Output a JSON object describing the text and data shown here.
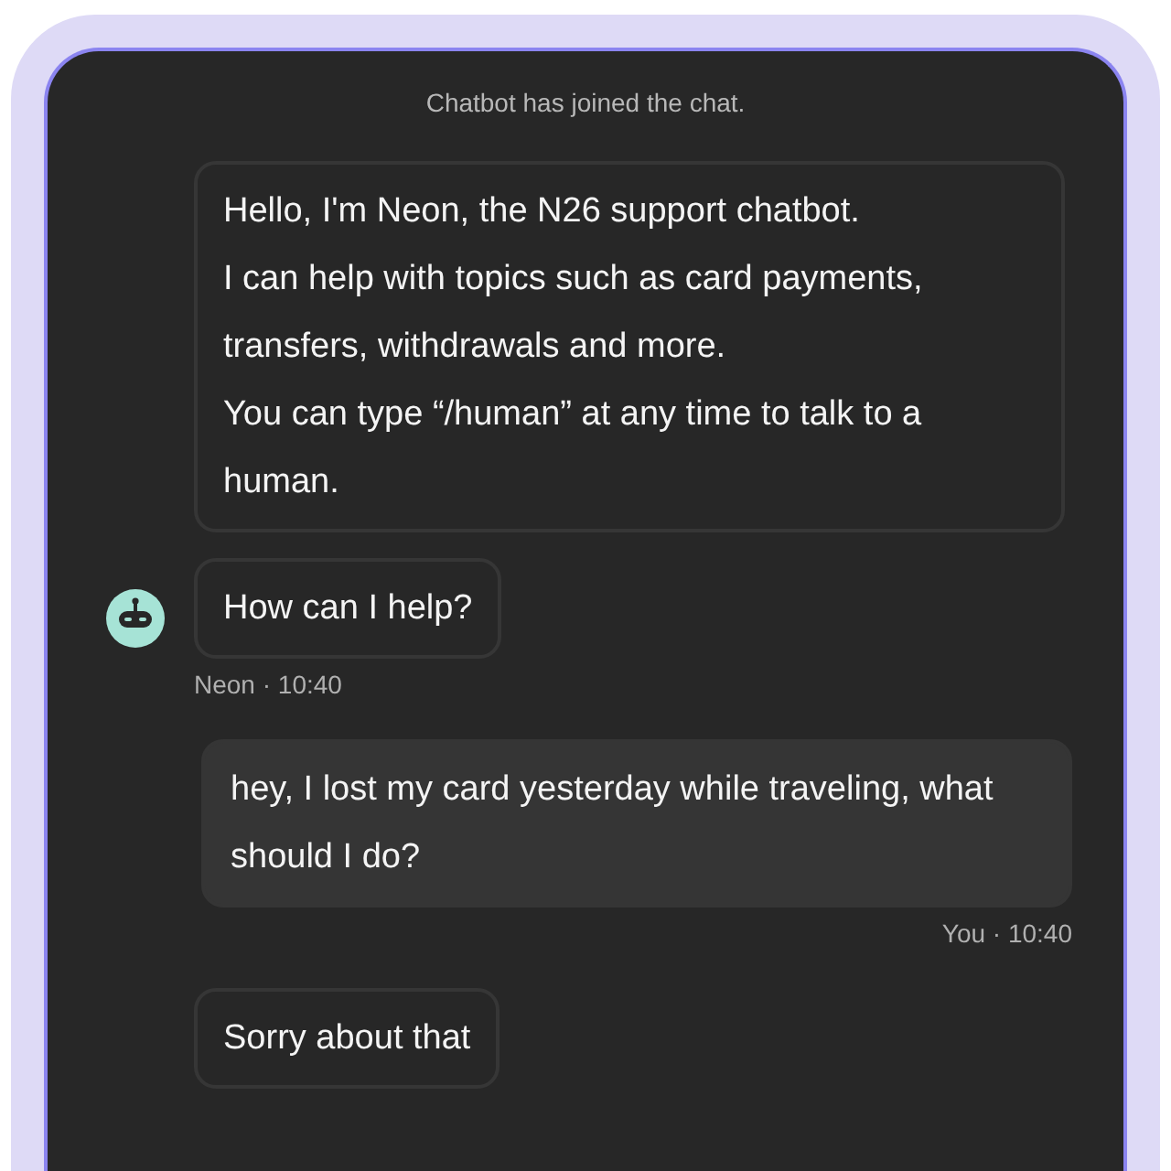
{
  "system_message": "Chatbot has joined the chat.",
  "groups": [
    {
      "kind": "bot",
      "messages": [
        "Hello, I'm Neon, the N26 support chatbot.\nI can help with topics such as card payments, transfers, withdrawals and more.\nYou can type “/human” at any time to talk to a human.",
        "How can I help?"
      ],
      "meta": "Neon · 10:40"
    },
    {
      "kind": "user",
      "messages": [
        "hey, I lost my card yesterday while traveling, what should I do?"
      ],
      "meta": "You · 10:40"
    },
    {
      "kind": "bot",
      "messages": [
        "Sorry about that"
      ]
    }
  ]
}
